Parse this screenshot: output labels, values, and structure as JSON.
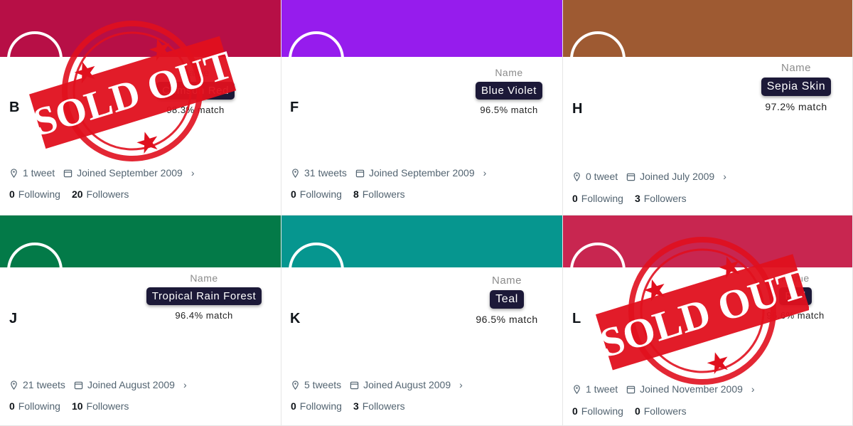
{
  "cards": [
    {
      "letter": "B",
      "name_caption": "Name",
      "name": "Crimson Red",
      "match": "98.3% match",
      "tweets": "1 tweet",
      "joined": "Joined September 2009",
      "following_count": "0",
      "following_label": "Following",
      "followers_count": "20",
      "followers_label": "Followers",
      "color": "#b70f46",
      "sold_out": true
    },
    {
      "letter": "F",
      "name_caption": "Name",
      "name": "Blue Violet",
      "match": "96.5% match",
      "tweets": "31 tweets",
      "joined": "Joined September 2009",
      "following_count": "0",
      "following_label": "Following",
      "followers_count": "8",
      "followers_label": "Followers",
      "color": "#961ced",
      "sold_out": false
    },
    {
      "letter": "H",
      "name_caption": "Name",
      "name": "Sepia Skin",
      "match": "97.2% match",
      "tweets": "0 tweet",
      "joined": "Joined July 2009",
      "following_count": "0",
      "following_label": "Following",
      "followers_count": "3",
      "followers_label": "Followers",
      "color": "#9e5a32",
      "sold_out": false
    },
    {
      "letter": "J",
      "name_caption": "Name",
      "name": "Tropical Rain Forest",
      "match": "96.4% match",
      "tweets": "21 tweets",
      "joined": "Joined August 2009",
      "following_count": "0",
      "following_label": "Following",
      "followers_count": "10",
      "followers_label": "Followers",
      "color": "#037a48",
      "sold_out": false
    },
    {
      "letter": "K",
      "name_caption": "Name",
      "name": "Teal",
      "match": "96.5% match",
      "tweets": "5 tweets",
      "joined": "Joined August 2009",
      "following_count": "0",
      "following_label": "Following",
      "followers_count": "3",
      "followers_label": "Followers",
      "color": "#06968f",
      "sold_out": false
    },
    {
      "letter": "L",
      "name_caption": "Name",
      "name": "Red",
      "match": "96.6% match",
      "tweets": "1 tweet",
      "joined": "Joined November 2009",
      "following_count": "0",
      "following_label": "Following",
      "followers_count": "0",
      "followers_label": "Followers",
      "color": "#c82650",
      "sold_out": true
    }
  ],
  "stamp_text": "SOLD OUT",
  "stamp_color": "#e0101e"
}
